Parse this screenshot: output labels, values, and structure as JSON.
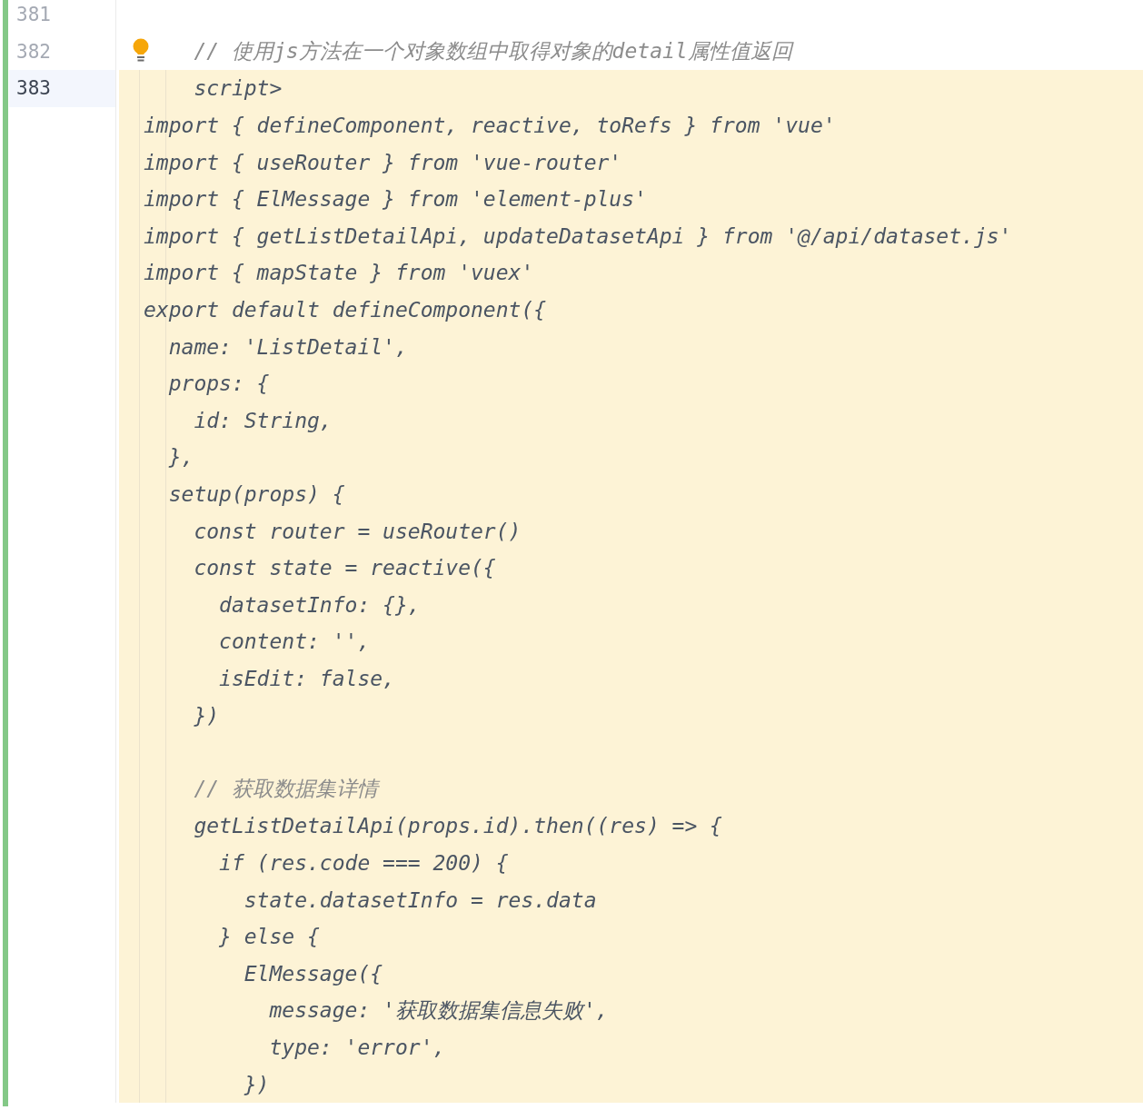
{
  "editor": {
    "rows": [
      {
        "number": "381",
        "current": false,
        "highlighted": false
      },
      {
        "number": "382",
        "current": false,
        "highlighted": false,
        "bulb": true,
        "kind": "comment",
        "code": "    // 使用js方法在一个对象数组中取得对象的detail属性值返回"
      },
      {
        "number": "383",
        "current": true,
        "highlighted": true,
        "kind": "code",
        "code": "    script>"
      },
      {
        "current": false,
        "highlighted": true,
        "kind": "code",
        "code": "import { defineComponent, reactive, toRefs } from 'vue'"
      },
      {
        "current": false,
        "highlighted": true,
        "kind": "code",
        "code": "import { useRouter } from 'vue-router'"
      },
      {
        "current": false,
        "highlighted": true,
        "kind": "code",
        "code": "import { ElMessage } from 'element-plus'"
      },
      {
        "current": false,
        "highlighted": true,
        "kind": "code",
        "code": "import { getListDetailApi, updateDatasetApi } from '@/api/dataset.js'"
      },
      {
        "current": false,
        "highlighted": true,
        "kind": "code",
        "code": "import { mapState } from 'vuex'"
      },
      {
        "current": false,
        "highlighted": true,
        "kind": "code",
        "code": "export default defineComponent({"
      },
      {
        "current": false,
        "highlighted": true,
        "kind": "code",
        "code": "  name: 'ListDetail',"
      },
      {
        "current": false,
        "highlighted": true,
        "kind": "code",
        "code": "  props: {"
      },
      {
        "current": false,
        "highlighted": true,
        "kind": "code",
        "code": "    id: String,"
      },
      {
        "current": false,
        "highlighted": true,
        "kind": "code",
        "code": "  },"
      },
      {
        "current": false,
        "highlighted": true,
        "kind": "code",
        "code": "  setup(props) {"
      },
      {
        "current": false,
        "highlighted": true,
        "kind": "code",
        "code": "    const router = useRouter()"
      },
      {
        "current": false,
        "highlighted": true,
        "kind": "code",
        "code": "    const state = reactive({"
      },
      {
        "current": false,
        "highlighted": true,
        "kind": "code",
        "code": "      datasetInfo: {},"
      },
      {
        "current": false,
        "highlighted": true,
        "kind": "code",
        "code": "      content: '',"
      },
      {
        "current": false,
        "highlighted": true,
        "kind": "code",
        "code": "      isEdit: false,"
      },
      {
        "current": false,
        "highlighted": true,
        "kind": "code",
        "code": "    })"
      },
      {
        "current": false,
        "highlighted": true
      },
      {
        "current": false,
        "highlighted": true,
        "kind": "comment",
        "code": "    // 获取数据集详情"
      },
      {
        "current": false,
        "highlighted": true,
        "kind": "code",
        "code": "    getListDetailApi(props.id).then((res) => {"
      },
      {
        "current": false,
        "highlighted": true,
        "kind": "code",
        "code": "      if (res.code === 200) {"
      },
      {
        "current": false,
        "highlighted": true,
        "kind": "code",
        "code": "        state.datasetInfo = res.data"
      },
      {
        "current": false,
        "highlighted": true,
        "kind": "code",
        "code": "      } else {"
      },
      {
        "current": false,
        "highlighted": true,
        "kind": "code",
        "code": "        ElMessage({"
      },
      {
        "current": false,
        "highlighted": true,
        "kind": "code",
        "code": "          message: '获取数据集信息失败',"
      },
      {
        "current": false,
        "highlighted": true,
        "kind": "code",
        "code": "          type: 'error',"
      },
      {
        "current": false,
        "highlighted": true,
        "kind": "code",
        "code": "        })"
      }
    ]
  }
}
